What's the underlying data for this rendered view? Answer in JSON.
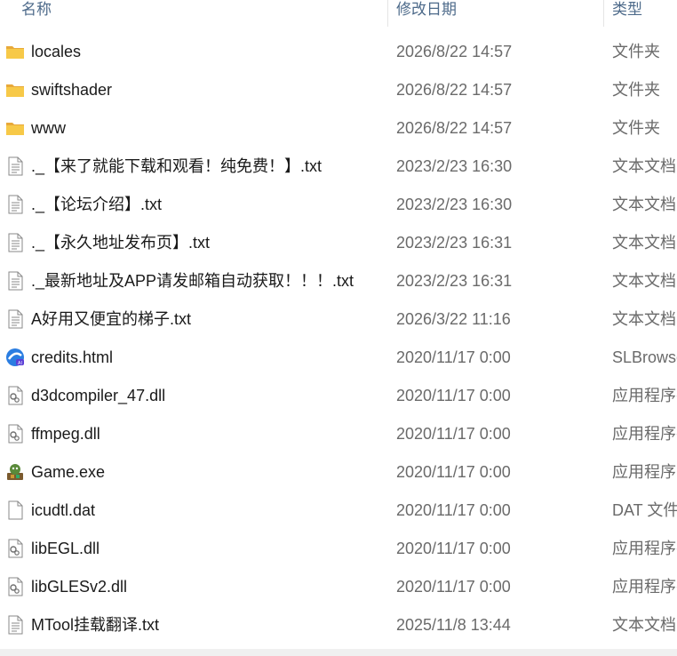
{
  "columns": {
    "name": "名称",
    "date": "修改日期",
    "type": "类型"
  },
  "files": [
    {
      "name": "locales",
      "date": "2026/8/22 14:57",
      "type": "文件夹",
      "icon": "folder-icon"
    },
    {
      "name": "swiftshader",
      "date": "2026/8/22 14:57",
      "type": "文件夹",
      "icon": "folder-icon"
    },
    {
      "name": "www",
      "date": "2026/8/22 14:57",
      "type": "文件夹",
      "icon": "folder-icon"
    },
    {
      "name": "._【来了就能下载和观看！纯免费！】.txt",
      "date": "2023/2/23 16:30",
      "type": "文本文档",
      "icon": "text-file-icon"
    },
    {
      "name": "._【论坛介绍】.txt",
      "date": "2023/2/23 16:30",
      "type": "文本文档",
      "icon": "text-file-icon"
    },
    {
      "name": "._【永久地址发布页】.txt",
      "date": "2023/2/23 16:31",
      "type": "文本文档",
      "icon": "text-file-icon"
    },
    {
      "name": "._最新地址及APP请发邮箱自动获取！！！.txt",
      "date": "2023/2/23 16:31",
      "type": "文本文档",
      "icon": "text-file-icon"
    },
    {
      "name": "A好用又便宜的梯子.txt",
      "date": "2026/3/22 11:16",
      "type": "文本文档",
      "icon": "text-file-icon"
    },
    {
      "name": "credits.html",
      "date": "2020/11/17 0:00",
      "type": "SLBrowser",
      "icon": "slbrowser-icon"
    },
    {
      "name": "d3dcompiler_47.dll",
      "date": "2020/11/17 0:00",
      "type": "应用程序扩展",
      "icon": "dll-icon"
    },
    {
      "name": "ffmpeg.dll",
      "date": "2020/11/17 0:00",
      "type": "应用程序扩展",
      "icon": "dll-icon"
    },
    {
      "name": "Game.exe",
      "date": "2020/11/17 0:00",
      "type": "应用程序",
      "icon": "game-exe-icon"
    },
    {
      "name": "icudtl.dat",
      "date": "2020/11/17 0:00",
      "type": "DAT 文件",
      "icon": "blank-file-icon"
    },
    {
      "name": "libEGL.dll",
      "date": "2020/11/17 0:00",
      "type": "应用程序扩展",
      "icon": "dll-icon"
    },
    {
      "name": "libGLESv2.dll",
      "date": "2020/11/17 0:00",
      "type": "应用程序扩展",
      "icon": "dll-icon"
    },
    {
      "name": "MTool挂载翻译.txt",
      "date": "2025/11/8 13:44",
      "type": "文本文档",
      "icon": "text-file-icon"
    }
  ],
  "colors": {
    "folder": "#f4c14a",
    "header_text": "#4d6a8a",
    "secondary_text": "#6a6a6a"
  }
}
